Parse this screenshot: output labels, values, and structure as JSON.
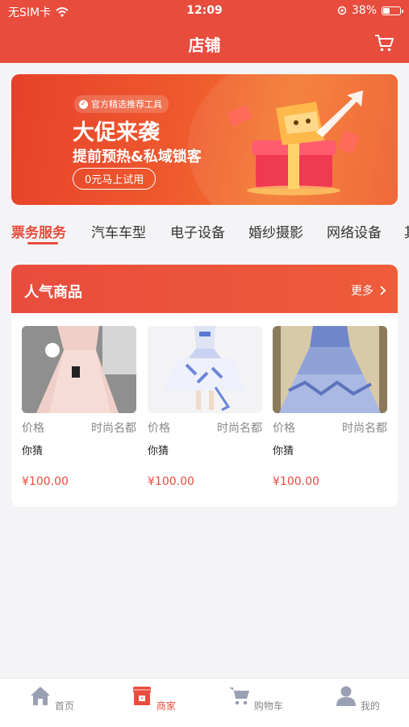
{
  "status_bar": {
    "carrier": "无SIM卡",
    "time": "12:09",
    "battery": "38%",
    "battery_level": 0.38
  },
  "header": {
    "title": "店铺",
    "cart_icon": "cart-icon"
  },
  "banner": {
    "tag": "官方精选推荐工具",
    "headline": "大促来袭",
    "subline": "提前预热&私域锁客",
    "cta": "0元马上试用"
  },
  "tabs": [
    "票务服务",
    "汽车车型",
    "电子设备",
    "婚纱摄影",
    "网络设备",
    "其"
  ],
  "active_tab": 0,
  "section": {
    "title": "人气商品",
    "more": "更多"
  },
  "products": [
    {
      "label": "价格",
      "tag": "时尚名都",
      "name": "你猜",
      "price": "¥100.00"
    },
    {
      "label": "价格",
      "tag": "时尚名都",
      "name": "你猜",
      "price": "¥100.00"
    },
    {
      "label": "价格",
      "tag": "时尚名都",
      "name": "你猜",
      "price": "¥100.00"
    }
  ],
  "tabbar": [
    {
      "label": "首页",
      "icon": "home-icon"
    },
    {
      "label": "商家",
      "icon": "store-icon"
    },
    {
      "label": "购物车",
      "icon": "cart-icon"
    },
    {
      "label": "我的",
      "icon": "user-icon"
    }
  ],
  "colors": {
    "accent": "#e84c3d",
    "inactive": "#888888"
  }
}
